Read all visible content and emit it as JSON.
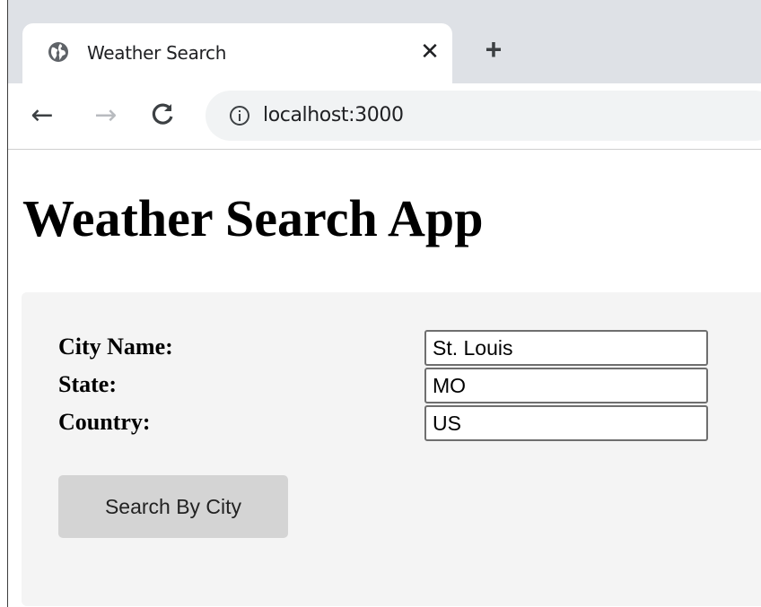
{
  "browser": {
    "tab_title": "Weather Search",
    "tab_close": "✕",
    "new_tab": "+",
    "back": "←",
    "forward": "→",
    "reload": "C",
    "url": "localhost:3000"
  },
  "page": {
    "title": "Weather Search App",
    "form": {
      "city_label": "City Name:",
      "city_value": "St. Louis",
      "state_label": "State:",
      "state_value": "MO",
      "country_label": "Country:",
      "country_value": "US",
      "button_label": "Search By City"
    }
  },
  "colors": {
    "tabstrip": "#dee1e6",
    "panel": "#f4f4f4",
    "button": "#d4d4d4"
  }
}
